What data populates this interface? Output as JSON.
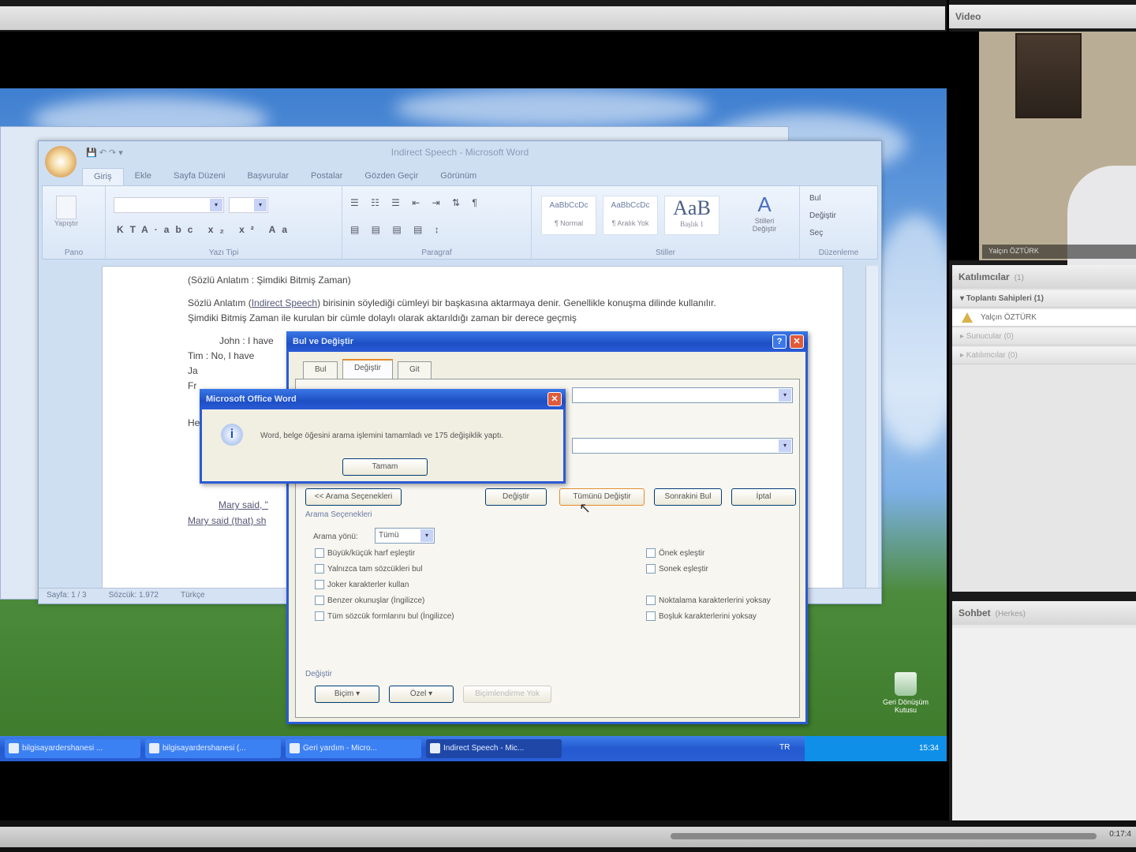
{
  "word": {
    "title": "Indirect Speech - Microsoft Word",
    "tabs": [
      "Giriş",
      "Ekle",
      "Sayfa Düzeni",
      "Başvurular",
      "Postalar",
      "Gözden Geçir",
      "Görünüm"
    ],
    "groups": {
      "clipboard": "Pano",
      "font": "Yazı Tipi",
      "paragraph": "Paragraf",
      "styles": "Stiller",
      "editing": "Düzenleme"
    },
    "paste": "Yapıştır",
    "styles": [
      {
        "sample": "AaBbCcDc",
        "name": "¶ Normal"
      },
      {
        "sample": "AaBbCcDc",
        "name": "¶ Aralık Yok"
      },
      {
        "sample": "AaB",
        "name": "Başlık 1"
      }
    ],
    "change_styles": "Stilleri Değiştir",
    "editing": [
      "Bul",
      "Değiştir",
      "Seç"
    ],
    "doc": {
      "heading": "(Sözlü Anlatım : Şimdiki Bitmiş Zaman)",
      "para_pre": "Sözlü Anlatım (",
      "para_link": "Indirect Speech",
      "para_post": ") birisinin söylediği cümleyi bir başkasına aktarmaya denir. Genellikle konuşma dilinde kullanılır. Şimdiki Bitmiş Zaman ile kurulan bir cümle dolaylı olarak aktarıldığı zaman bir derece geçmiş",
      "lines": [
        "John : I have",
        "Tim : No, I have",
        "Ja",
        "Fr",
        "He"
      ],
      "mary1": "Mary said, \"",
      "mary2": "Mary said (that) sh"
    },
    "status": [
      "Sayfa: 1 / 3",
      "Sözcük: 1.972",
      "Türkçe"
    ]
  },
  "find": {
    "title": "Bul ve Değiştir",
    "tabs": [
      "Bul",
      "Değiştir",
      "Git"
    ],
    "buttons": {
      "less": "<< Arama Seçenekleri",
      "replace": "Değiştir",
      "replace_all": "Tümünü Değiştir",
      "find_next": "Sonrakini Bul",
      "cancel": "İptal"
    },
    "options_label": "Arama Seçenekleri",
    "direction_label": "Arama yönü:",
    "direction_value": "Tümü",
    "left_checks": [
      "Büyük/küçük harf eşleştir",
      "Yalnızca tam sözcükleri bul",
      "Joker karakterler kullan",
      "Benzer okunuşlar (İngilizce)",
      "Tüm sözcük formlarını bul (İngilizce)"
    ],
    "right_checks": [
      "Önek eşleştir",
      "Sonek eşleştir",
      "Noktalama karakterlerini yoksay",
      "Boşluk karakterlerini yoksay"
    ],
    "replace_section": "Değiştir",
    "format": "Biçim ▾",
    "special": "Özel ▾",
    "no_format": "Biçimlendirme Yok"
  },
  "msg": {
    "title": "Microsoft Office Word",
    "text": "Word, belge öğesini arama işlemini tamamladı ve 175 değişiklik yaptı.",
    "ok": "Tamam"
  },
  "taskbar": {
    "items": [
      "bilgisayardershanesi ...",
      "bilgisayardershanesi (...",
      "Geri yardım - Micro...",
      "Indirect Speech - Mic..."
    ],
    "lang": "TR",
    "clock": "15:34"
  },
  "desktop_icon": "Geri Dönüşüm Kutusu",
  "right": {
    "video_title": "Video",
    "presenter": "Yalçın ÖZTÜRK",
    "participants_title": "Katılımcılar",
    "participants_count": "(1)",
    "hosts": "▾ Toplantı Sahipleri (1)",
    "host_name": "Yalçın ÖZTÜRK",
    "presenters": "▸ Sunucular (0)",
    "attendees": "▸ Katılımcılar (0)",
    "chat_title": "Sohbet",
    "chat_scope": "(Herkes)"
  },
  "bottom": {
    "time": "0:17:4"
  }
}
